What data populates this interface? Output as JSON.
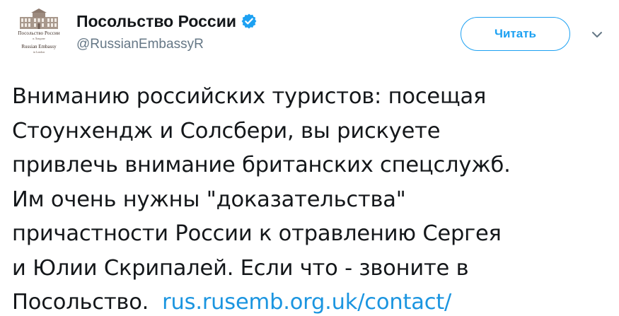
{
  "account": {
    "display_name": "Посольство России",
    "handle": "@RussianEmbassyR",
    "verified_icon": "verified-badge-icon",
    "avatar": {
      "line1": "Посольство России",
      "line2": "в Лондоне",
      "line3": "Russian Embassy",
      "line4": "in London"
    }
  },
  "follow_button": {
    "label": "Читать"
  },
  "menu": {
    "icon": "chevron-down-icon"
  },
  "tweet": {
    "lines": [
      "Вниманию российских туристов: посещая",
      "Стоунхендж и Солсбери, вы рискуете",
      "привлечь внимание британских спецслужб.",
      "Им очень нужны \"доказательства\"",
      "причастности России к отравлению Сергея",
      "и Юлии Скрипалей. Если что - звоните в"
    ],
    "last_line_text": "Посольство.",
    "link": "rus.rusemb.org.uk/contact/"
  },
  "colors": {
    "accent": "#1da1f2",
    "link": "#1b95e0",
    "text": "#14171a",
    "secondary": "#657786"
  }
}
